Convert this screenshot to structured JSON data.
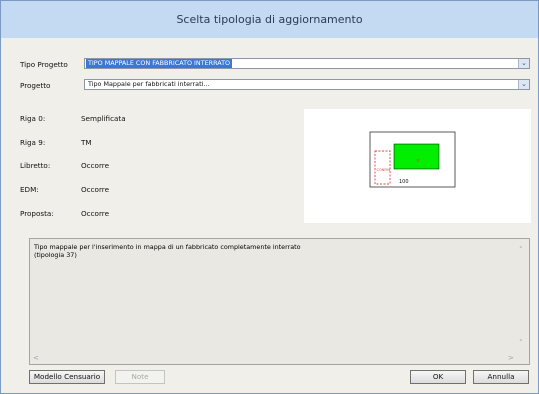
{
  "window": {
    "title": "Scelta tipologia di aggiornamento"
  },
  "form": {
    "tipo_progetto_label": "Tipo Progetto",
    "tipo_progetto_value": "TIPO MAPPALE CON FABBRICATO INTERRATO",
    "progetto_label": "Progetto",
    "progetto_value": "Tipo Mappale per fabbricati interrati..."
  },
  "info": [
    {
      "label": "Riga 0:",
      "value": "Semplificata"
    },
    {
      "label": "Riga 9:",
      "value": "TM"
    },
    {
      "label": "Libretto:",
      "value": "Occorre"
    },
    {
      "label": "EDM:",
      "value": "Occorre"
    },
    {
      "label": "Proposta:",
      "value": "Occorre"
    }
  ],
  "preview": {
    "number": "100",
    "small_label": "CONFIN",
    "fill_color": "#00ee00",
    "dashed_color": "#e04040"
  },
  "description": "Tipo mappale per l'inserimento in mappa di un fabbricato completamente interrato\n(tipologia 37)",
  "buttons": {
    "modello": "Modello Censuario",
    "note": "Note",
    "ok": "OK",
    "annulla": "Annulla"
  }
}
